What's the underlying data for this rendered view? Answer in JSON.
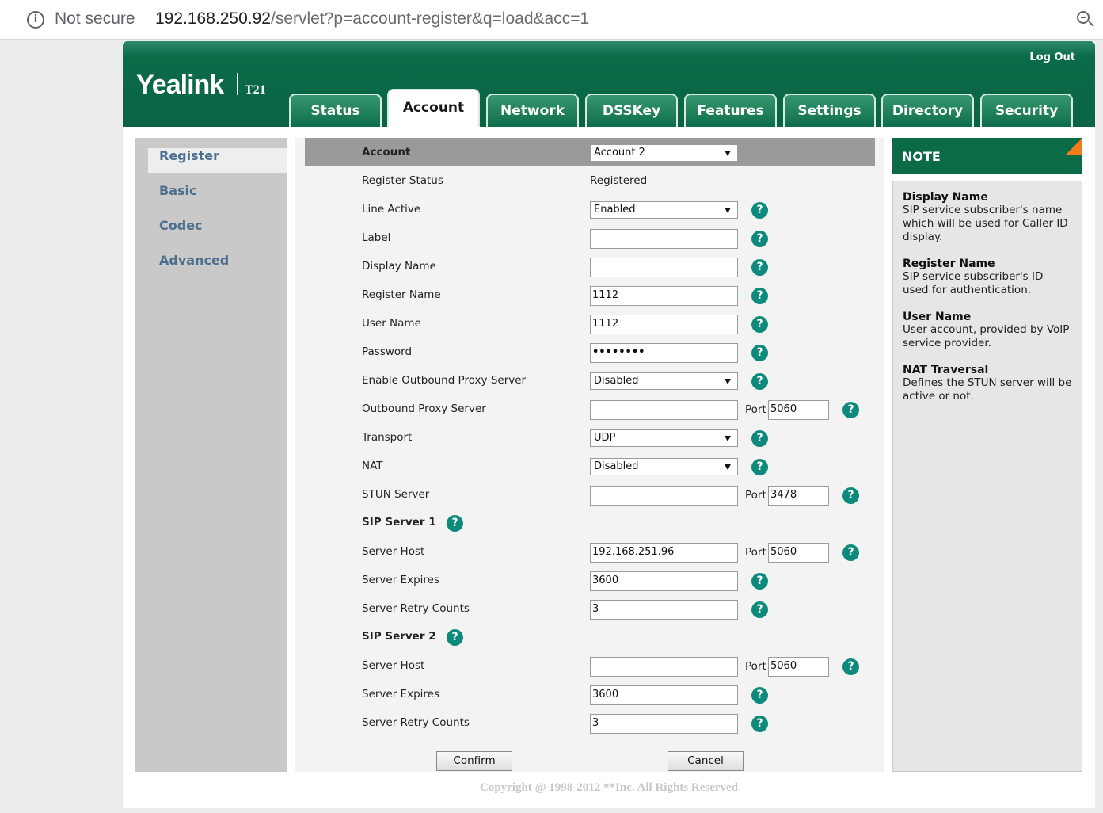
{
  "browser": {
    "security_label": "Not secure",
    "url_host": "192.168.250.92",
    "url_path": "/servlet?p=account-register&q=load&acc=1"
  },
  "header": {
    "brand": "Yealink",
    "model": "T21",
    "logout": "Log Out",
    "tabs": [
      "Status",
      "Account",
      "Network",
      "DSSKey",
      "Features",
      "Settings",
      "Directory",
      "Security"
    ],
    "active_tab": "Account"
  },
  "sidebar": {
    "items": [
      "Register",
      "Basic",
      "Codec",
      "Advanced"
    ],
    "active": "Register"
  },
  "form": {
    "account_label": "Account",
    "account_value": "Account 2",
    "register_status_label": "Register Status",
    "register_status_value": "Registered",
    "line_active_label": "Line Active",
    "line_active_value": "Enabled",
    "label_label": "Label",
    "label_value": "",
    "display_name_label": "Display Name",
    "display_name_value": "",
    "register_name_label": "Register Name",
    "register_name_value": "1112",
    "user_name_label": "User Name",
    "user_name_value": "1112",
    "password_label": "Password",
    "password_value": "••••••••",
    "outbound_proxy_enable_label": "Enable Outbound Proxy Server",
    "outbound_proxy_enable_value": "Disabled",
    "outbound_proxy_label": "Outbound Proxy Server",
    "outbound_proxy_value": "",
    "outbound_proxy_port": "5060",
    "transport_label": "Transport",
    "transport_value": "UDP",
    "nat_label": "NAT",
    "nat_value": "Disabled",
    "stun_label": "STUN Server",
    "stun_value": "",
    "stun_port": "3478",
    "port_label": "Port",
    "help_glyph": "?",
    "sip1": {
      "title": "SIP Server 1",
      "host_label": "Server Host",
      "host_value": "192.168.251.96",
      "host_port": "5060",
      "expires_label": "Server Expires",
      "expires_value": "3600",
      "retry_label": "Server Retry Counts",
      "retry_value": "3"
    },
    "sip2": {
      "title": "SIP Server 2",
      "host_label": "Server Host",
      "host_value": "",
      "host_port": "5060",
      "expires_label": "Server Expires",
      "expires_value": "3600",
      "retry_label": "Server Retry Counts",
      "retry_value": "3"
    },
    "confirm": "Confirm",
    "cancel": "Cancel"
  },
  "note": {
    "title": "NOTE",
    "items": [
      {
        "title": "Display Name",
        "text": "SIP service subscriber's name which will be used for Caller ID display."
      },
      {
        "title": "Register Name",
        "text": "SIP service subscriber's ID used for authentication."
      },
      {
        "title": "User Name",
        "text": "User account, provided by VoIP service provider."
      },
      {
        "title": "NAT Traversal",
        "text": "Defines the STUN server will be active or not."
      }
    ]
  },
  "footer": {
    "copyright": "Copyright @ 1998-2012 **Inc. All Rights Reserved"
  },
  "colors": {
    "brand_green": "#0b6b47",
    "help_teal": "#0d8a7b",
    "note_corner_orange": "#f07c1c",
    "menu_text": "#4d6f8d"
  }
}
